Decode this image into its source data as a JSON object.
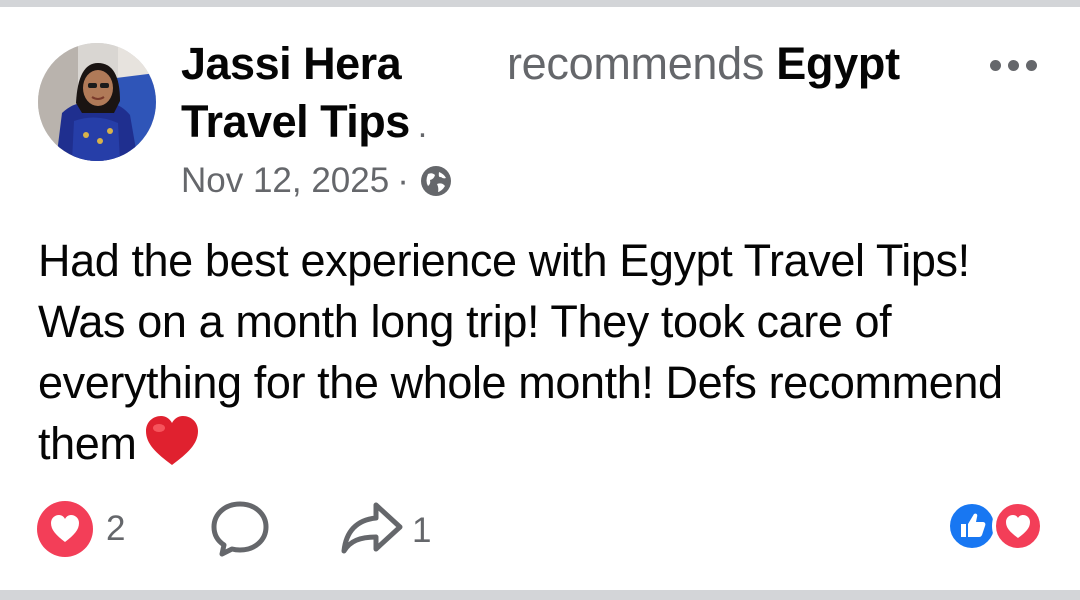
{
  "post": {
    "author_line1": "Jassi Hera",
    "author_line2": "Travel Tips",
    "author_line2_suffix": ".",
    "recommends_label": "recommends",
    "recommended_page": "Egypt",
    "date": "Nov 12, 2025",
    "date_separator": "·",
    "privacy_icon": "globe-icon",
    "text": "Had the best experience with Egypt Travel Tips! Was on a month long trip! They took care of everything for the whole month! Defs recommend them",
    "emoji": "red-heart"
  },
  "actions": {
    "reaction_count": "2",
    "share_count": "1"
  },
  "colors": {
    "text_primary": "#050505",
    "text_secondary": "#65676b",
    "love_red": "#f33e58",
    "like_blue": "#1877f2",
    "divider": "#d3d5d8"
  }
}
